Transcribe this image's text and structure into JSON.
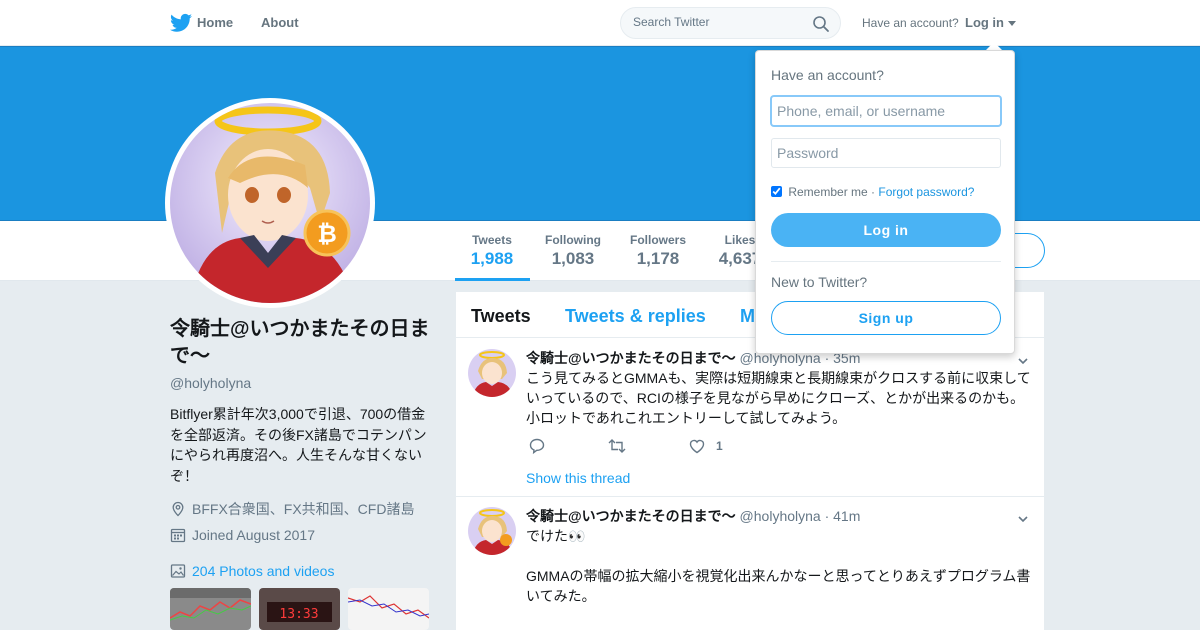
{
  "colors": {
    "brand": "#1da1f2",
    "banner": "#1b95e0",
    "text_primary": "#14171a",
    "text_secondary": "#657786",
    "background": "#e6ecf0"
  },
  "nav": {
    "logo_icon": "twitter-bird-icon",
    "home_label": "Home",
    "about_label": "About",
    "search_placeholder": "Search Twitter",
    "search_value": "",
    "have_account": "Have an account?",
    "login_label": "Log in"
  },
  "profile": {
    "name": "令騎士@いつかまたその日まで〜",
    "handle": "@holyholyna",
    "bio": "Bitflyer累計年次3,000で引退、700の借金を全部返済。その後FX諸島でコテンパンにやられ再度沼へ。人生そんな甘くないぞ！",
    "location": "BFFX合衆国、FX共和国、CFD諸島",
    "joined": "Joined August 2017",
    "photos": "204 Photos and videos"
  },
  "stats": [
    {
      "label": "Tweets",
      "value": "1,988"
    },
    {
      "label": "Following",
      "value": "1,083"
    },
    {
      "label": "Followers",
      "value": "1,178"
    },
    {
      "label": "Likes",
      "value": "4,637"
    }
  ],
  "timeline": {
    "tabs": [
      "Tweets",
      "Tweets & replies",
      "Media"
    ],
    "tweets": [
      {
        "name": "令騎士@いつかまたその日まで〜",
        "handle": "@holyholyna",
        "time": "· 35m",
        "text": "こう見てみるとGMMAも、実際は短期線束と長期線束がクロスする前に収束していっているので、RCIの様子を見ながら早めにクローズ、とかが出来るのかも。小ロットであれこれエントリーして試してみよう。",
        "likes": "1",
        "show_thread": "Show this thread"
      },
      {
        "name": "令騎士@いつかまたその日まで〜",
        "handle": "@holyholyna",
        "time": "· 41m",
        "text": "でけた👀\n\nGMMAの帯幅の拡大縮小を視覚化出来んかなーと思ってとりあえずプログラム書いてみた。"
      }
    ]
  },
  "login_dropdown": {
    "title": "Have an account?",
    "username_placeholder": "Phone, email, or username",
    "username_value": "",
    "password_placeholder": "Password",
    "password_value": "",
    "remember_label": "Remember me",
    "remember_checked": true,
    "separator": "·",
    "forgot_label": "Forgot password?",
    "login_button": "Log in",
    "new_label": "New to Twitter?",
    "signup_button": "Sign up"
  }
}
